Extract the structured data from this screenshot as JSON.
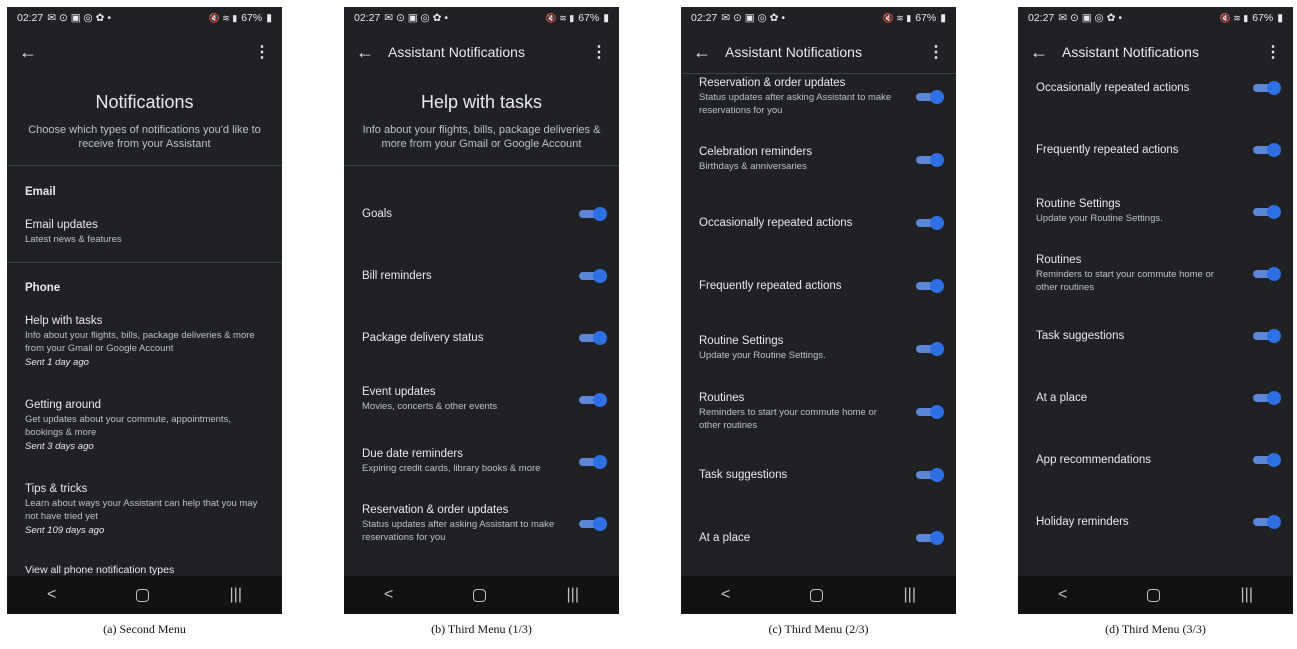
{
  "status_bar": {
    "time": "02:27",
    "battery": "67%"
  },
  "phone_a": {
    "title": "Notifications",
    "subtitle": "Choose which types of notifications you'd like to receive from your Assistant",
    "email_section": "Email",
    "email_updates": {
      "title": "Email updates",
      "subtitle": "Latest news & features"
    },
    "phone_section": "Phone",
    "items": [
      {
        "title": "Help with tasks",
        "subtitle": "Info about your flights, bills, package deliveries & more from your Gmail or Google Account",
        "sent": "Sent 1 day ago"
      },
      {
        "title": "Getting around",
        "subtitle": "Get updates about your commute, appointments, bookings & more",
        "sent": "Sent 3 days ago"
      },
      {
        "title": "Tips & tricks",
        "subtitle": "Learn about ways your Assistant can help that you may not have tried yet",
        "sent": "Sent 109 days ago"
      }
    ],
    "view_all": "View all phone notification types"
  },
  "appbar_title": "Assistant Notifications",
  "phone_b": {
    "title": "Help with tasks",
    "subtitle": "Info about your flights, bills, package deliveries & more from your Gmail or Google Account",
    "rows": [
      {
        "title": "Goals",
        "subtitle": "",
        "on": true
      },
      {
        "title": "Bill reminders",
        "subtitle": "",
        "on": true
      },
      {
        "title": "Package delivery status",
        "subtitle": "",
        "on": true
      },
      {
        "title": "Event updates",
        "subtitle": "Movies, concerts & other events",
        "on": true
      },
      {
        "title": "Due date reminders",
        "subtitle": "Expiring credit cards, library books & more",
        "on": true
      },
      {
        "title": "Reservation & order updates",
        "subtitle": "Status updates after asking Assistant to make reservations for you",
        "on": true
      }
    ]
  },
  "phone_c": {
    "rows": [
      {
        "title": "Reservation & order updates",
        "subtitle": "Status updates after asking Assistant to make reservations for you",
        "on": true
      },
      {
        "title": "Celebration reminders",
        "subtitle": "Birthdays & anniversaries",
        "on": true
      },
      {
        "title": "Occasionally repeated actions",
        "subtitle": "",
        "on": true
      },
      {
        "title": "Frequently repeated actions",
        "subtitle": "",
        "on": true
      },
      {
        "title": "Routine Settings",
        "subtitle": "Update your Routine Settings.",
        "on": true
      },
      {
        "title": "Routines",
        "subtitle": "Reminders to start your commute home or other routines",
        "on": true
      },
      {
        "title": "Task suggestions",
        "subtitle": "",
        "on": true
      },
      {
        "title": "At a place",
        "subtitle": "",
        "on": true
      }
    ]
  },
  "phone_d": {
    "rows": [
      {
        "title": "Occasionally repeated actions",
        "subtitle": "",
        "on": true
      },
      {
        "title": "Frequently repeated actions",
        "subtitle": "",
        "on": true
      },
      {
        "title": "Routine Settings",
        "subtitle": "Update your Routine Settings.",
        "on": true
      },
      {
        "title": "Routines",
        "subtitle": "Reminders to start your commute home or other routines",
        "on": true
      },
      {
        "title": "Task suggestions",
        "subtitle": "",
        "on": true
      },
      {
        "title": "At a place",
        "subtitle": "",
        "on": true
      },
      {
        "title": "App recommendations",
        "subtitle": "",
        "on": true
      },
      {
        "title": "Holiday reminders",
        "subtitle": "",
        "on": true
      }
    ]
  },
  "captions": [
    "(a) Second Menu",
    "(b) Third Menu (1/3)",
    "(c) Third Menu (2/3)",
    "(d) Third Menu (3/3)"
  ],
  "nav": {
    "back": "<",
    "recents": "|||"
  },
  "icons": {
    "back": "arrow-left-icon",
    "menu": "more-vert-icon"
  }
}
